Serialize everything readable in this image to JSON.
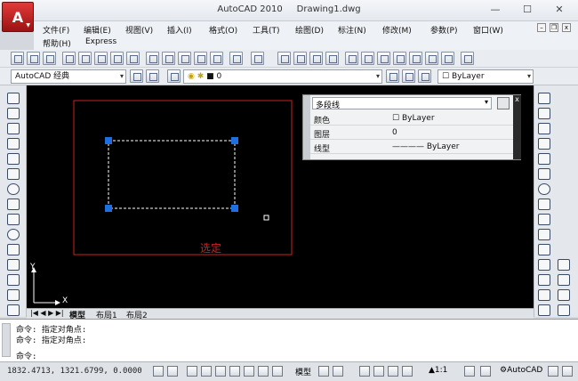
{
  "app": {
    "title": "AutoCAD 2010",
    "document": "Drawing1.dwg",
    "logo_letter": "A"
  },
  "window_controls": {
    "minimize": "—",
    "maximize": "☐",
    "close": "✕"
  },
  "menu": {
    "items": [
      "文件(F)",
      "编辑(E)",
      "视图(V)",
      "插入(I)",
      "格式(O)",
      "工具(T)",
      "绘图(D)",
      "标注(N)",
      "修改(M)",
      "参数(P)",
      "窗口(W)"
    ],
    "items_row2": [
      "帮助(H)",
      "Express"
    ]
  },
  "toolbar2": {
    "workspace": "AutoCAD 经典",
    "layer": "0",
    "color": "ByLayer"
  },
  "properties_panel": {
    "selector": "多段线",
    "rows": [
      {
        "label": "颜色",
        "value": "ByLayer"
      },
      {
        "label": "图层",
        "value": "0"
      },
      {
        "label": "线型",
        "value": "ByLayer"
      }
    ]
  },
  "canvas": {
    "selection_label": "选定",
    "axis_x": "X",
    "axis_y": "Y",
    "colors": {
      "frame": "#cc2222",
      "grip": "#1e6fe0",
      "dash": "#ffffff",
      "label": "#cc2222"
    }
  },
  "layout_tabs": [
    "模型",
    "布局1",
    "布局2"
  ],
  "command": {
    "lines": [
      "命令: 指定对角点:",
      "命令: 指定对角点:"
    ],
    "prompt": "命令:"
  },
  "status": {
    "coords": "1832.4713, 1321.6799, 0.0000",
    "model": "模型",
    "scale": "1:1",
    "workspace": "AutoCAD"
  }
}
